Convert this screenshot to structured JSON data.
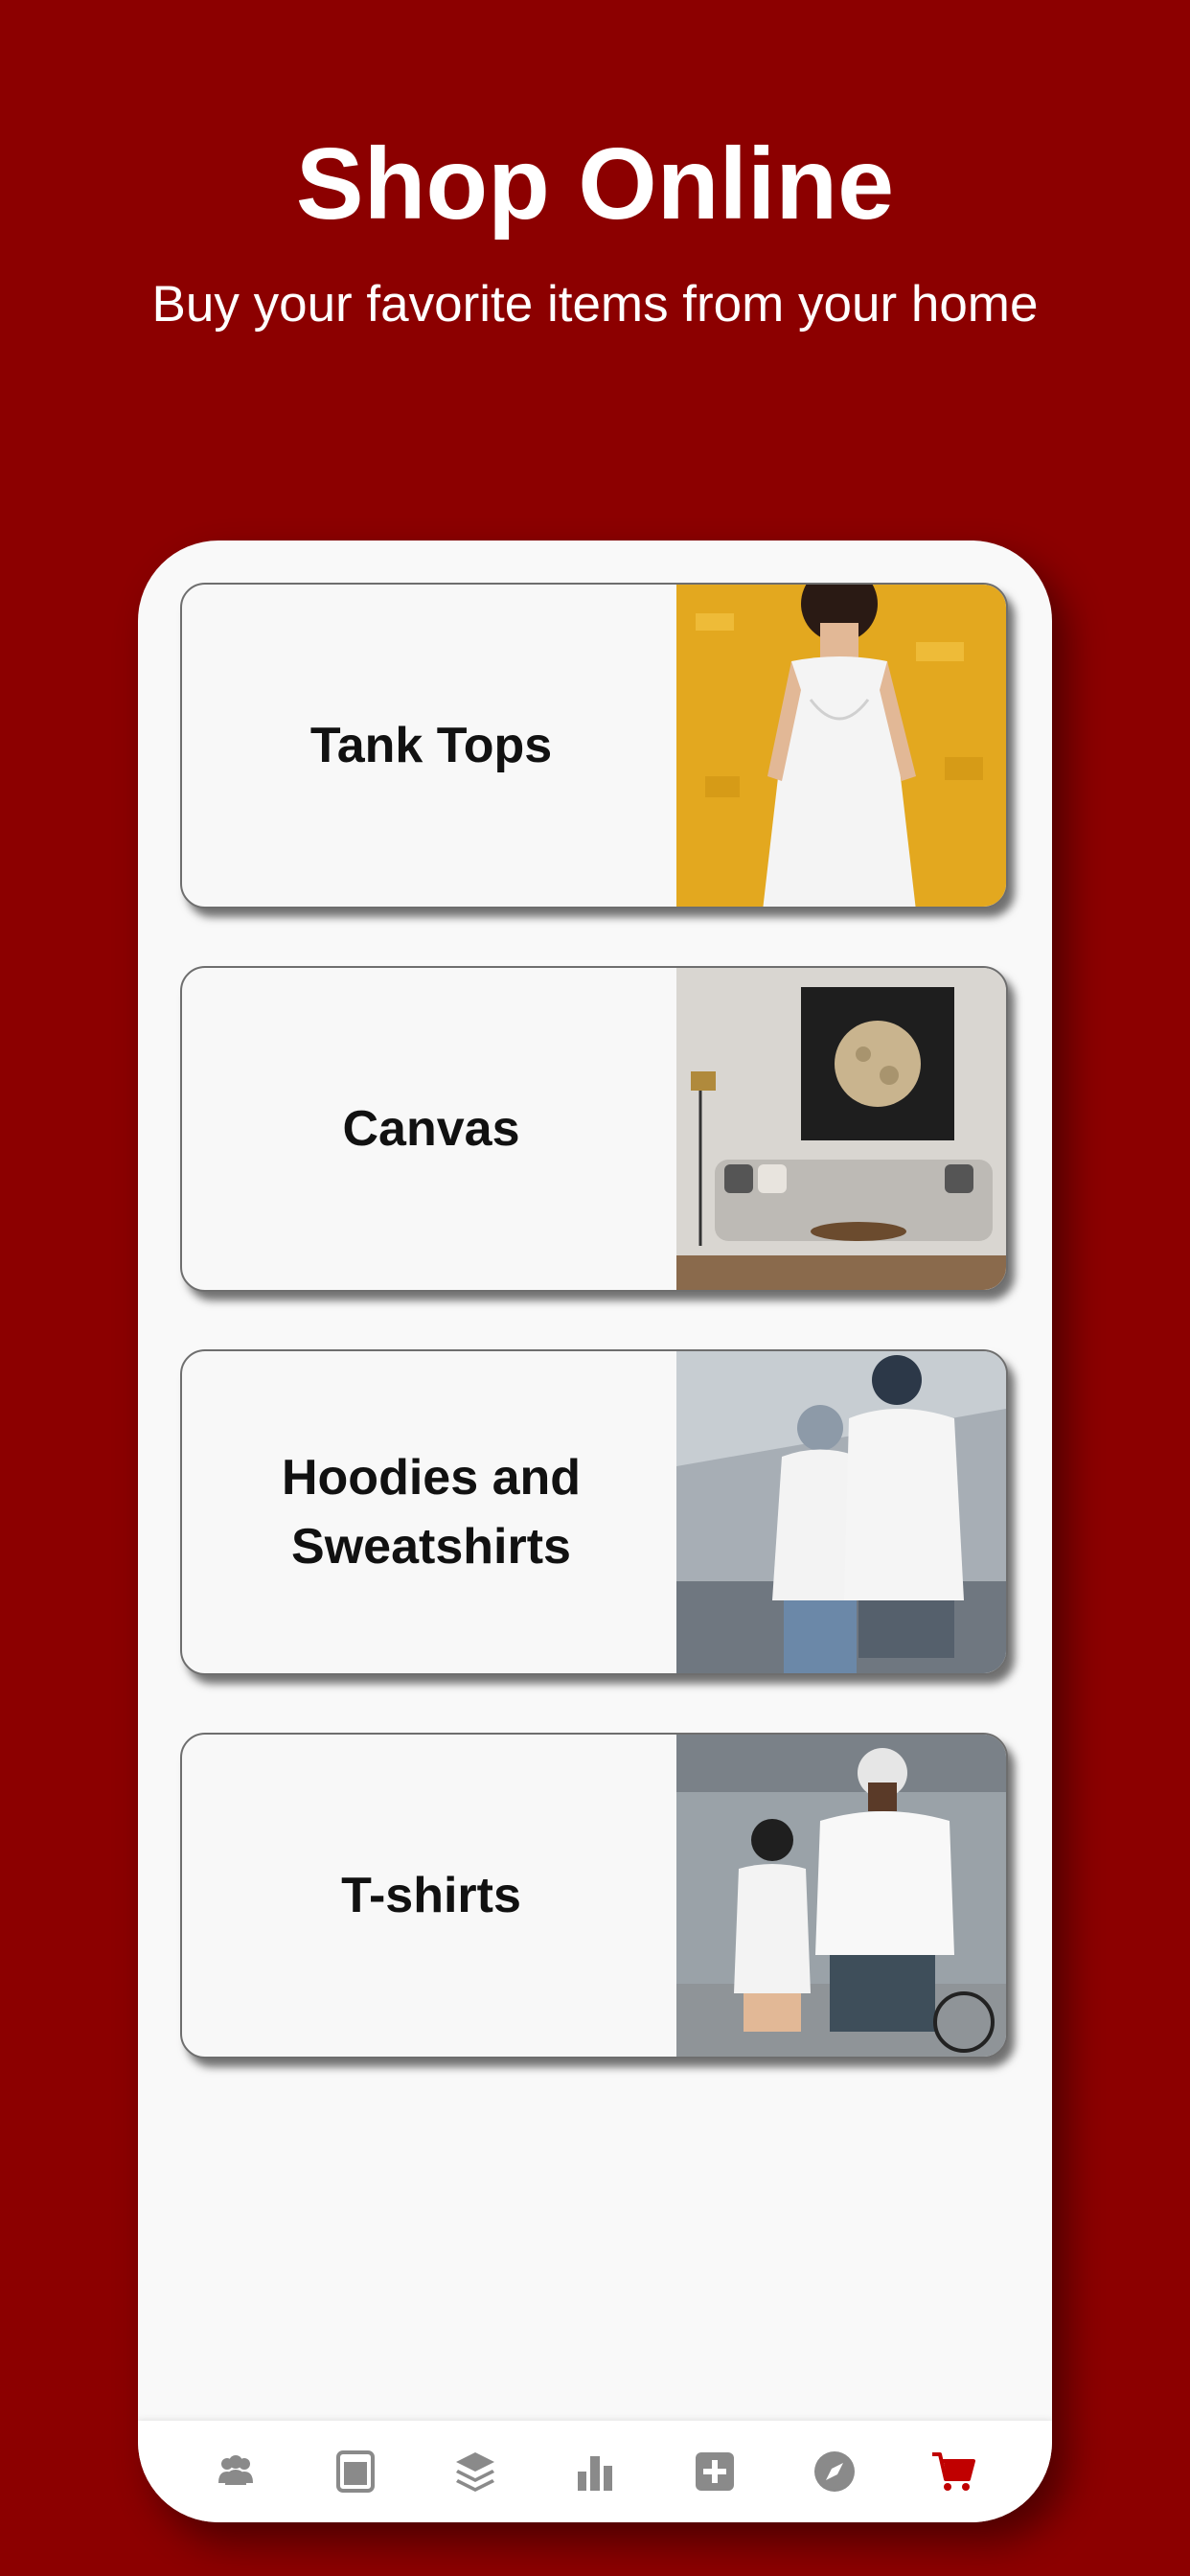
{
  "header": {
    "title": "Shop Online",
    "subtitle": "Buy your favorite items from your home"
  },
  "categories": [
    {
      "label": "Tank Tops",
      "image_icon": "woman-white-tank-top-photo"
    },
    {
      "label": "Canvas",
      "image_icon": "living-room-moon-canvas-photo"
    },
    {
      "label": "Hoodies and Sweatshirts",
      "image_icon": "couple-white-hoodies-photo"
    },
    {
      "label": "T-shirts",
      "image_icon": "couple-white-tshirts-photo"
    }
  ],
  "tab_bar": {
    "items": [
      {
        "icon": "people-icon",
        "active": false
      },
      {
        "icon": "page-icon",
        "active": false
      },
      {
        "icon": "layers-icon",
        "active": false
      },
      {
        "icon": "bar-chart-icon",
        "active": false
      },
      {
        "icon": "plus-box-icon",
        "active": false
      },
      {
        "icon": "compass-icon",
        "active": false
      },
      {
        "icon": "cart-icon",
        "active": true
      }
    ]
  },
  "colors": {
    "background": "#8c0000",
    "panel": "#f9f9f9",
    "card": "#f8f8f8",
    "inactive_icon": "#8a8a8a",
    "active_icon": "#c00000",
    "text": "#111111",
    "header_text": "#ffffff"
  }
}
